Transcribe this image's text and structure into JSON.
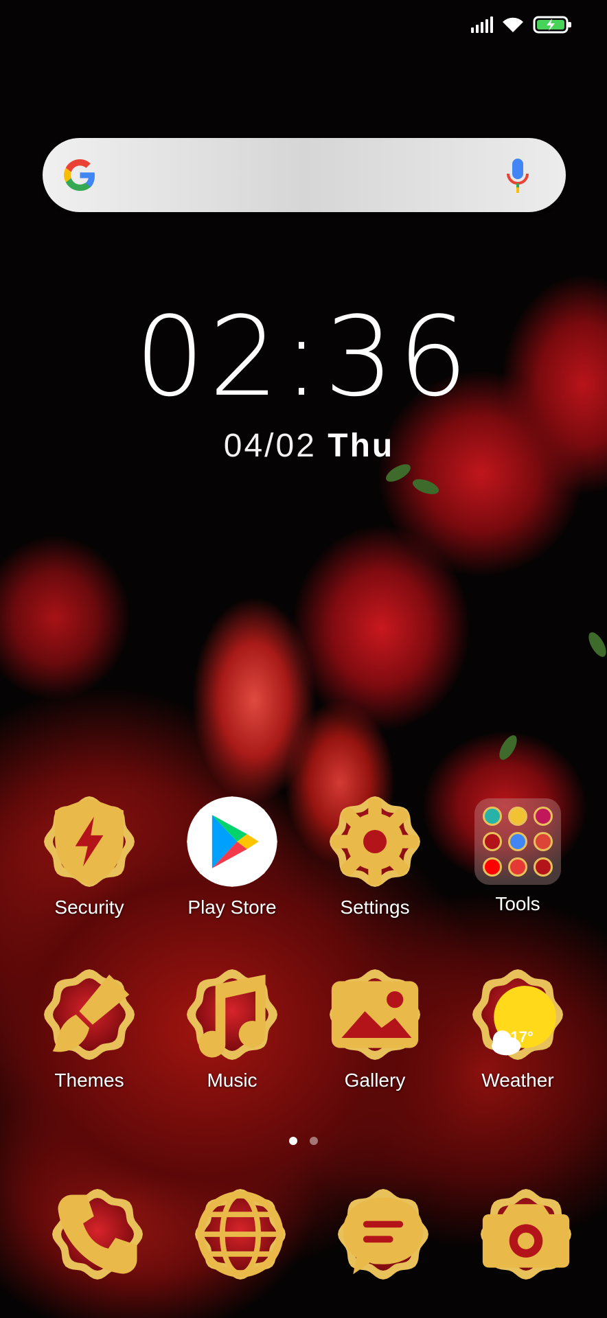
{
  "status_bar": {
    "icons": [
      "signal-icon",
      "wifi-icon",
      "battery-charging-icon"
    ]
  },
  "search_widget": {
    "logo": "google-logo-icon",
    "voice": "microphone-icon"
  },
  "clock": {
    "time": "02:36",
    "date": "04/02",
    "weekday": "Thu"
  },
  "apps_row1": [
    {
      "label": "Security",
      "icon": "shield-bolt-icon"
    },
    {
      "label": "Play Store",
      "icon": "play-store-icon"
    },
    {
      "label": "Settings",
      "icon": "gear-icon"
    },
    {
      "label": "Tools",
      "icon": "folder-icon"
    }
  ],
  "apps_row2": [
    {
      "label": "Themes",
      "icon": "paintbrush-icon"
    },
    {
      "label": "Music",
      "icon": "music-note-icon"
    },
    {
      "label": "Gallery",
      "icon": "image-icon"
    },
    {
      "label": "Weather",
      "icon": "sun-cloud-icon",
      "temperature": "17°"
    }
  ],
  "page_indicator": {
    "pages": 2,
    "current": 1
  },
  "dock": [
    {
      "icon": "phone-icon"
    },
    {
      "icon": "globe-icon"
    },
    {
      "icon": "chat-bubble-icon"
    },
    {
      "icon": "camera-icon"
    }
  ],
  "colors": {
    "badge_gold": "#e8c15a",
    "badge_red": "#b3141a",
    "glyph_gold": "#e9b949"
  }
}
